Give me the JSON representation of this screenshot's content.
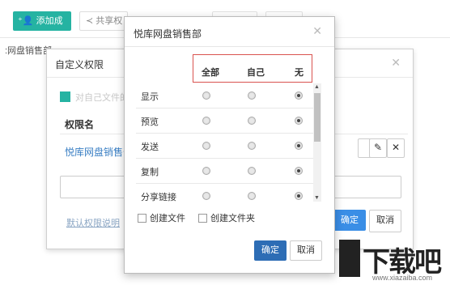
{
  "toolbar": {
    "add_member_label": "添加成员",
    "share_label": "共享权"
  },
  "breadcrumb": ":网盘销售部",
  "back_dialog": {
    "title": "自定义权限",
    "faded_option": "对自己文件的",
    "perm_header": "权限名",
    "group_name": "悦库网盘销售部",
    "default_link": "默认权限说明",
    "ok_label": "确定",
    "cancel_label": "取消"
  },
  "front_dialog": {
    "title": "悦库网盘销售部",
    "columns": [
      "全部",
      "自己",
      "无"
    ],
    "permissions": [
      {
        "label": "显示",
        "selected": "无"
      },
      {
        "label": "预览",
        "selected": "无"
      },
      {
        "label": "发送",
        "selected": "无"
      },
      {
        "label": "复制",
        "selected": "无"
      },
      {
        "label": "分享链接",
        "selected": "无"
      }
    ],
    "options": [
      "创建文件",
      "创建文件夹"
    ],
    "ok_label": "确定",
    "cancel_label": "取消"
  },
  "watermark": {
    "logo_text": "下载吧",
    "url": "www.xiazaiba.com"
  },
  "colors": {
    "teal": "#25b3a2",
    "primary_blue": "#2d6db5",
    "highlight_red": "#d9534f"
  }
}
